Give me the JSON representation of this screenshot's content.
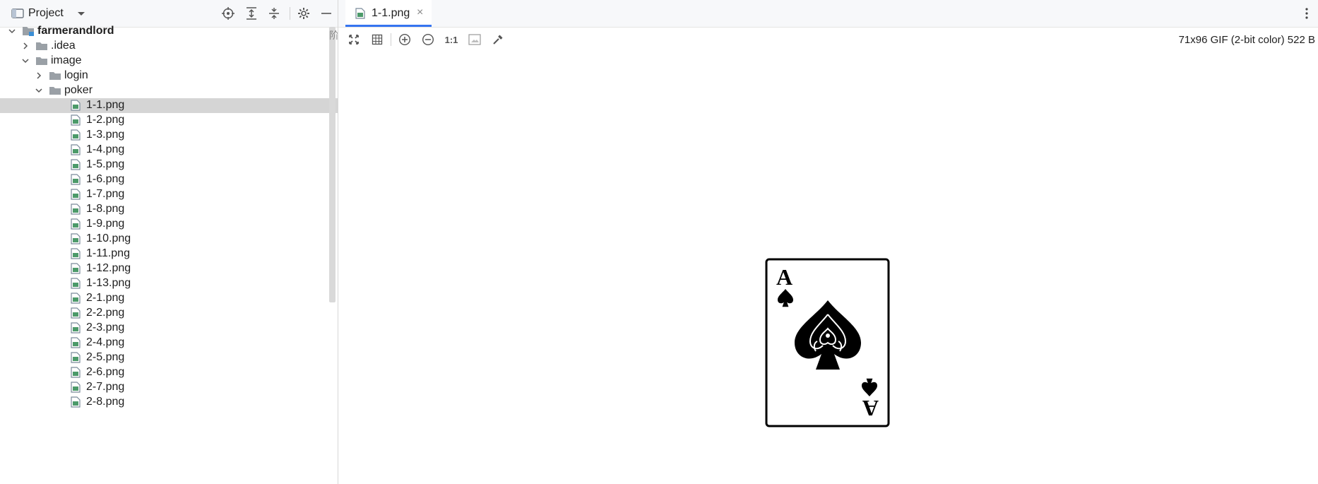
{
  "project_panel": {
    "title": "Project",
    "dropdown_icon": "caret-down-icon",
    "actions": [
      {
        "name": "locate-icon"
      },
      {
        "name": "expand-all-icon"
      },
      {
        "name": "collapse-all-icon"
      },
      {
        "name": "settings-icon"
      },
      {
        "name": "hide-icon"
      }
    ],
    "clipped_text": "阶"
  },
  "tree": [
    {
      "label": "farmerandlord",
      "kind": "module",
      "expanded": true,
      "bold": true
    },
    {
      "label": ".idea",
      "kind": "folder",
      "expanded": false
    },
    {
      "label": "image",
      "kind": "folder",
      "expanded": true
    },
    {
      "label": "login",
      "kind": "folder",
      "expanded": false
    },
    {
      "label": "poker",
      "kind": "folder",
      "expanded": true
    },
    {
      "label": "1-1.png",
      "kind": "image",
      "selected": true
    },
    {
      "label": "1-2.png",
      "kind": "image"
    },
    {
      "label": "1-3.png",
      "kind": "image"
    },
    {
      "label": "1-4.png",
      "kind": "image"
    },
    {
      "label": "1-5.png",
      "kind": "image"
    },
    {
      "label": "1-6.png",
      "kind": "image"
    },
    {
      "label": "1-7.png",
      "kind": "image"
    },
    {
      "label": "1-8.png",
      "kind": "image"
    },
    {
      "label": "1-9.png",
      "kind": "image"
    },
    {
      "label": "1-10.png",
      "kind": "image"
    },
    {
      "label": "1-11.png",
      "kind": "image"
    },
    {
      "label": "1-12.png",
      "kind": "image"
    },
    {
      "label": "1-13.png",
      "kind": "image"
    },
    {
      "label": "2-1.png",
      "kind": "image"
    },
    {
      "label": "2-2.png",
      "kind": "image"
    },
    {
      "label": "2-3.png",
      "kind": "image"
    },
    {
      "label": "2-4.png",
      "kind": "image"
    },
    {
      "label": "2-5.png",
      "kind": "image"
    },
    {
      "label": "2-6.png",
      "kind": "image"
    },
    {
      "label": "2-7.png",
      "kind": "image"
    },
    {
      "label": "2-8.png",
      "kind": "image"
    }
  ],
  "editor": {
    "tab": {
      "label": "1-1.png",
      "close": "×"
    },
    "toolbar": {
      "zoom_actual_label": "1:1",
      "image_info": "71x96 GIF (2-bit color) 522 B"
    },
    "card": {
      "rank": "A",
      "suit": "spade"
    }
  },
  "colors": {
    "accent": "#3574f0",
    "selection": "#d5d5d5",
    "folder": "#9aa0a6",
    "image_file": "#4c9a6a"
  }
}
